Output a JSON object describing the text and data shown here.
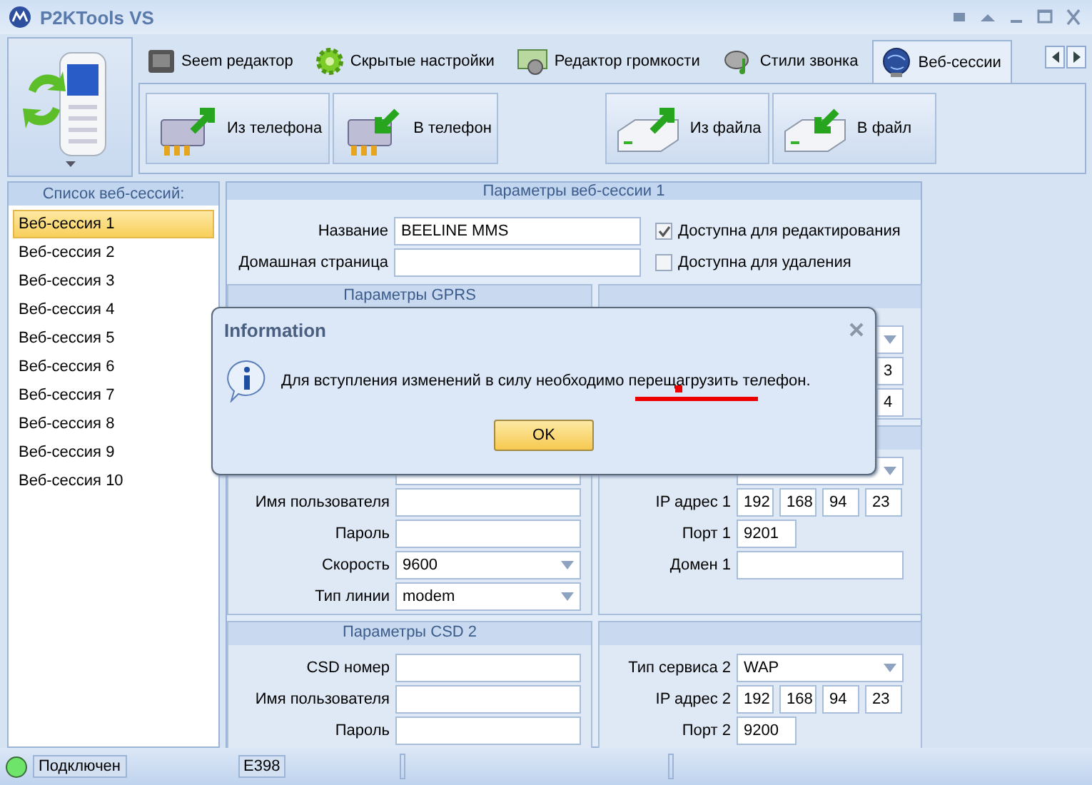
{
  "window": {
    "title": "P2KTools VS"
  },
  "tabs": [
    {
      "label": "Seem редактор",
      "selected": false
    },
    {
      "label": "Скрытые настройки",
      "selected": false
    },
    {
      "label": "Редактор громкости",
      "selected": false
    },
    {
      "label": "Стили звонка",
      "selected": false
    },
    {
      "label": "Веб-сессии",
      "selected": true
    }
  ],
  "ribbon_groups": [
    [
      {
        "label": "Из телефона",
        "kind": "chip-out"
      },
      {
        "label": "В телефон",
        "kind": "chip-in"
      }
    ],
    [
      {
        "label": "Из файла",
        "kind": "drive-out"
      },
      {
        "label": "В файл",
        "kind": "drive-in"
      }
    ]
  ],
  "session_list": {
    "title": "Список веб-сессий:",
    "items": [
      {
        "label": "Веб-сессия 1",
        "selected": true
      },
      {
        "label": "Веб-сессия 2",
        "selected": false
      },
      {
        "label": "Веб-сессия 3",
        "selected": false
      },
      {
        "label": "Веб-сессия 4",
        "selected": false
      },
      {
        "label": "Веб-сессия 5",
        "selected": false
      },
      {
        "label": "Веб-сессия 6",
        "selected": false
      },
      {
        "label": "Веб-сессия 7",
        "selected": false
      },
      {
        "label": "Веб-сессия 8",
        "selected": false
      },
      {
        "label": "Веб-сессия 9",
        "selected": false
      },
      {
        "label": "Веб-сессия 10",
        "selected": false
      }
    ]
  },
  "session_params": {
    "title": "Параметры веб-сессии 1",
    "name_label": "Название",
    "name_value": "BEELINE MMS",
    "home_label": "Домашная страница",
    "options": [
      {
        "label": "Доступна для редактирования",
        "checked": true
      },
      {
        "label": "Доступна для удаления",
        "checked": false
      }
    ]
  },
  "gprs": {
    "title": "Параметры GPRS"
  },
  "gprs_server": {
    "field_values": [
      "3",
      "4"
    ]
  },
  "csd1": {
    "fields": [
      {
        "kind": "text"
      },
      {
        "label": "Имя пользователя",
        "kind": "text"
      },
      {
        "label": "Пароль",
        "kind": "text"
      },
      {
        "label": "Скорость",
        "kind": "select",
        "value": "9600"
      },
      {
        "label": "Тип линии",
        "kind": "select",
        "value": "modem"
      }
    ]
  },
  "server1": {
    "fields": [
      {
        "kind": "select"
      },
      {
        "label": "IP адрес 1",
        "kind": "ip",
        "octets": [
          "192",
          "168",
          "94",
          "23"
        ]
      },
      {
        "label": "Порт 1",
        "kind": "port",
        "value": "9201"
      },
      {
        "label": "Домен 1",
        "kind": "text"
      }
    ]
  },
  "csd2": {
    "title": "Параметры CSD 2",
    "fields": [
      {
        "label": "CSD номер",
        "kind": "text"
      },
      {
        "label": "Имя пользователя",
        "kind": "text"
      },
      {
        "label": "Пароль",
        "kind": "text"
      }
    ]
  },
  "server2": {
    "fields": [
      {
        "label": "Тип сервиса 2",
        "kind": "select",
        "value": "WAP"
      },
      {
        "label": "IP адрес 2",
        "kind": "ip",
        "octets": [
          "192",
          "168",
          "94",
          "23"
        ]
      },
      {
        "label": "Порт 2",
        "kind": "port",
        "value": "9200"
      }
    ]
  },
  "status_bar": {
    "connected": true,
    "state": "Подключен",
    "model": "E398"
  },
  "dialog": {
    "title": "Information",
    "message": "Для вступления изменений в силу необходимо перещагрузить телефон.",
    "button": "OK"
  }
}
